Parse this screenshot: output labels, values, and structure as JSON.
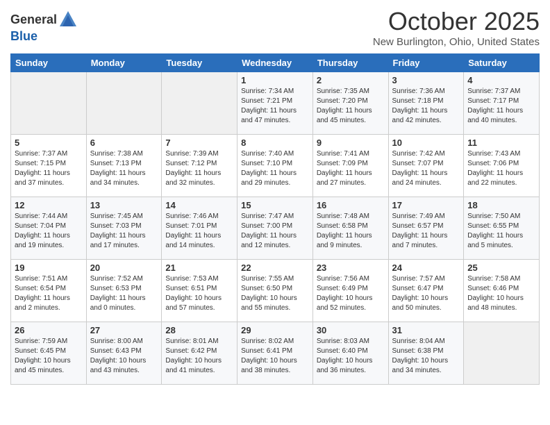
{
  "logo": {
    "general": "General",
    "blue": "Blue"
  },
  "title": "October 2025",
  "location": "New Burlington, Ohio, United States",
  "days_of_week": [
    "Sunday",
    "Monday",
    "Tuesday",
    "Wednesday",
    "Thursday",
    "Friday",
    "Saturday"
  ],
  "weeks": [
    [
      {
        "day": "",
        "info": ""
      },
      {
        "day": "",
        "info": ""
      },
      {
        "day": "",
        "info": ""
      },
      {
        "day": "1",
        "info": "Sunrise: 7:34 AM\nSunset: 7:21 PM\nDaylight: 11 hours\nand 47 minutes."
      },
      {
        "day": "2",
        "info": "Sunrise: 7:35 AM\nSunset: 7:20 PM\nDaylight: 11 hours\nand 45 minutes."
      },
      {
        "day": "3",
        "info": "Sunrise: 7:36 AM\nSunset: 7:18 PM\nDaylight: 11 hours\nand 42 minutes."
      },
      {
        "day": "4",
        "info": "Sunrise: 7:37 AM\nSunset: 7:17 PM\nDaylight: 11 hours\nand 40 minutes."
      }
    ],
    [
      {
        "day": "5",
        "info": "Sunrise: 7:37 AM\nSunset: 7:15 PM\nDaylight: 11 hours\nand 37 minutes."
      },
      {
        "day": "6",
        "info": "Sunrise: 7:38 AM\nSunset: 7:13 PM\nDaylight: 11 hours\nand 34 minutes."
      },
      {
        "day": "7",
        "info": "Sunrise: 7:39 AM\nSunset: 7:12 PM\nDaylight: 11 hours\nand 32 minutes."
      },
      {
        "day": "8",
        "info": "Sunrise: 7:40 AM\nSunset: 7:10 PM\nDaylight: 11 hours\nand 29 minutes."
      },
      {
        "day": "9",
        "info": "Sunrise: 7:41 AM\nSunset: 7:09 PM\nDaylight: 11 hours\nand 27 minutes."
      },
      {
        "day": "10",
        "info": "Sunrise: 7:42 AM\nSunset: 7:07 PM\nDaylight: 11 hours\nand 24 minutes."
      },
      {
        "day": "11",
        "info": "Sunrise: 7:43 AM\nSunset: 7:06 PM\nDaylight: 11 hours\nand 22 minutes."
      }
    ],
    [
      {
        "day": "12",
        "info": "Sunrise: 7:44 AM\nSunset: 7:04 PM\nDaylight: 11 hours\nand 19 minutes."
      },
      {
        "day": "13",
        "info": "Sunrise: 7:45 AM\nSunset: 7:03 PM\nDaylight: 11 hours\nand 17 minutes."
      },
      {
        "day": "14",
        "info": "Sunrise: 7:46 AM\nSunset: 7:01 PM\nDaylight: 11 hours\nand 14 minutes."
      },
      {
        "day": "15",
        "info": "Sunrise: 7:47 AM\nSunset: 7:00 PM\nDaylight: 11 hours\nand 12 minutes."
      },
      {
        "day": "16",
        "info": "Sunrise: 7:48 AM\nSunset: 6:58 PM\nDaylight: 11 hours\nand 9 minutes."
      },
      {
        "day": "17",
        "info": "Sunrise: 7:49 AM\nSunset: 6:57 PM\nDaylight: 11 hours\nand 7 minutes."
      },
      {
        "day": "18",
        "info": "Sunrise: 7:50 AM\nSunset: 6:55 PM\nDaylight: 11 hours\nand 5 minutes."
      }
    ],
    [
      {
        "day": "19",
        "info": "Sunrise: 7:51 AM\nSunset: 6:54 PM\nDaylight: 11 hours\nand 2 minutes."
      },
      {
        "day": "20",
        "info": "Sunrise: 7:52 AM\nSunset: 6:53 PM\nDaylight: 11 hours\nand 0 minutes."
      },
      {
        "day": "21",
        "info": "Sunrise: 7:53 AM\nSunset: 6:51 PM\nDaylight: 10 hours\nand 57 minutes."
      },
      {
        "day": "22",
        "info": "Sunrise: 7:55 AM\nSunset: 6:50 PM\nDaylight: 10 hours\nand 55 minutes."
      },
      {
        "day": "23",
        "info": "Sunrise: 7:56 AM\nSunset: 6:49 PM\nDaylight: 10 hours\nand 52 minutes."
      },
      {
        "day": "24",
        "info": "Sunrise: 7:57 AM\nSunset: 6:47 PM\nDaylight: 10 hours\nand 50 minutes."
      },
      {
        "day": "25",
        "info": "Sunrise: 7:58 AM\nSunset: 6:46 PM\nDaylight: 10 hours\nand 48 minutes."
      }
    ],
    [
      {
        "day": "26",
        "info": "Sunrise: 7:59 AM\nSunset: 6:45 PM\nDaylight: 10 hours\nand 45 minutes."
      },
      {
        "day": "27",
        "info": "Sunrise: 8:00 AM\nSunset: 6:43 PM\nDaylight: 10 hours\nand 43 minutes."
      },
      {
        "day": "28",
        "info": "Sunrise: 8:01 AM\nSunset: 6:42 PM\nDaylight: 10 hours\nand 41 minutes."
      },
      {
        "day": "29",
        "info": "Sunrise: 8:02 AM\nSunset: 6:41 PM\nDaylight: 10 hours\nand 38 minutes."
      },
      {
        "day": "30",
        "info": "Sunrise: 8:03 AM\nSunset: 6:40 PM\nDaylight: 10 hours\nand 36 minutes."
      },
      {
        "day": "31",
        "info": "Sunrise: 8:04 AM\nSunset: 6:38 PM\nDaylight: 10 hours\nand 34 minutes."
      },
      {
        "day": "",
        "info": ""
      }
    ]
  ]
}
